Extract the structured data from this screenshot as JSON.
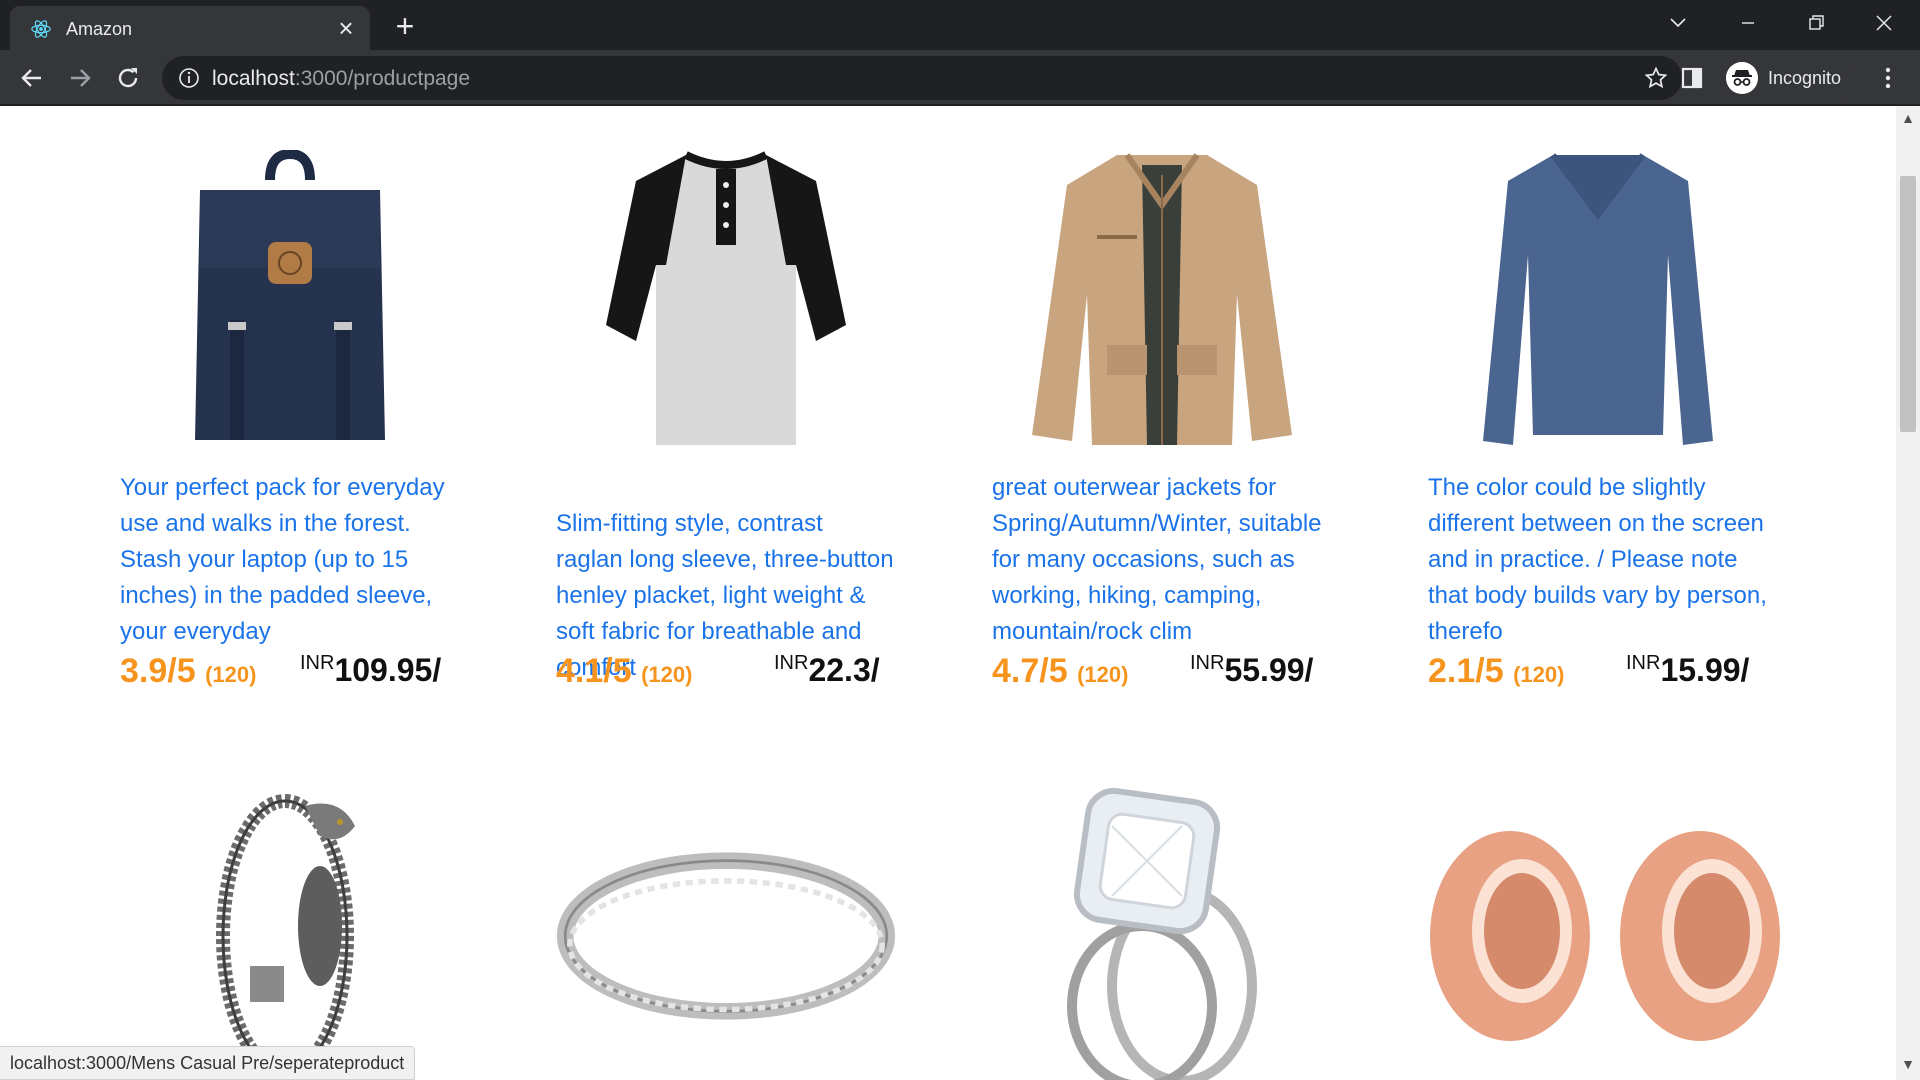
{
  "browser": {
    "tab_title": "Amazon",
    "url_host": "localhost",
    "url_path": ":3000/productpage",
    "profile_label": "Incognito"
  },
  "products_row1": [
    {
      "desc": "Your perfect pack for everyday use and walks in the forest. Stash your laptop (up to 15 inches) in the padded sleeve, your everyday",
      "rating": "3.9/5",
      "count": "(120)",
      "currency": "INR",
      "price": "109.95/"
    },
    {
      "desc": "Slim-fitting style, contrast raglan long sleeve, three-button henley placket, light weight & soft fabric for breathable and comfort",
      "rating": "4.1/5",
      "count": "(120)",
      "currency": "INR",
      "price": "22.3/"
    },
    {
      "desc": "great outerwear jackets for Spring/Autumn/Winter, suitable for many occasions, such as working, hiking, camping, mountain/rock clim",
      "rating": "4.7/5",
      "count": "(120)",
      "currency": "INR",
      "price": "55.99/"
    },
    {
      "desc": "The color could be slightly different between on the screen and in practice. / Please note that body builds vary by person, therefo",
      "rating": "2.1/5",
      "count": "(120)",
      "currency": "INR",
      "price": "15.99/"
    }
  ],
  "status_bar": {
    "text": "localhost:3000/Mens Casual Pre/seperateproduct"
  },
  "colors": {
    "description": "#1a73e8",
    "rating": "#f7941d",
    "price": "#111111"
  }
}
